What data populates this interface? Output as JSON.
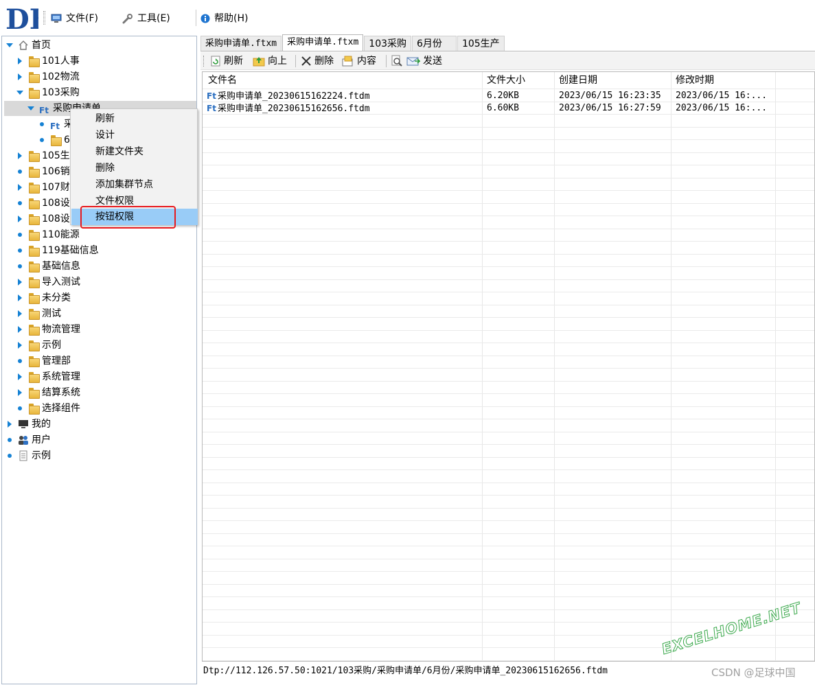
{
  "menubar": {
    "logo_text": "DE",
    "items": [
      {
        "label": "文件(F)",
        "icon": "computer-icon"
      },
      {
        "label": "工具(E)",
        "icon": "wrench-icon"
      },
      {
        "label": "帮助(H)",
        "icon": "info-icon"
      }
    ]
  },
  "tree": {
    "root": "首页",
    "nodes": [
      "101人事",
      "102物流",
      "103采购",
      "采购申请单",
      "采",
      "6",
      "105生",
      "106销",
      "107财",
      "108设",
      "108设",
      "110能源",
      "119基础信息",
      "基础信息",
      "导入测试",
      "未分类",
      "测试",
      "物流管理",
      "示例",
      "管理部",
      "系统管理",
      "结算系统",
      "选择组件",
      "我的",
      "用户",
      "示例"
    ]
  },
  "context_menu": {
    "items": [
      "刷新",
      "设计",
      "新建文件夹",
      "删除",
      "添加集群节点",
      "文件权限",
      "按钮权限"
    ],
    "highlighted": "按钮权限"
  },
  "tabs": [
    "采购申请单.ftxm",
    "采购申请单.ftxm",
    "103采购",
    "6月份",
    "105生产"
  ],
  "active_tab": 1,
  "toolbar": {
    "refresh": "刷新",
    "up": "向上",
    "delete": "删除",
    "content": "内容",
    "send": "发送"
  },
  "grid": {
    "columns": [
      "文件名",
      "文件大小",
      "创建日期",
      "修改时期"
    ],
    "rows": [
      {
        "name": "采购申请单_20230615162224.ftdm",
        "size": "6.20KB",
        "created": "2023/06/15 16:23:35",
        "modified": "2023/06/15 16:..."
      },
      {
        "name": "采购申请单_20230615162656.ftdm",
        "size": "6.60KB",
        "created": "2023/06/15 16:27:59",
        "modified": "2023/06/15 16:..."
      }
    ]
  },
  "status": "Dtp://112.126.57.50:1021/103采购/采购申请单/6月份/采购申请单_20230615162656.ftdm",
  "watermark": {
    "site": "EXCELHOME.NET",
    "credit": "CSDN @足球中国"
  },
  "colors": {
    "accent": "#1682d4",
    "highlight": "#99ccf7",
    "red_box": "#e8191d"
  }
}
